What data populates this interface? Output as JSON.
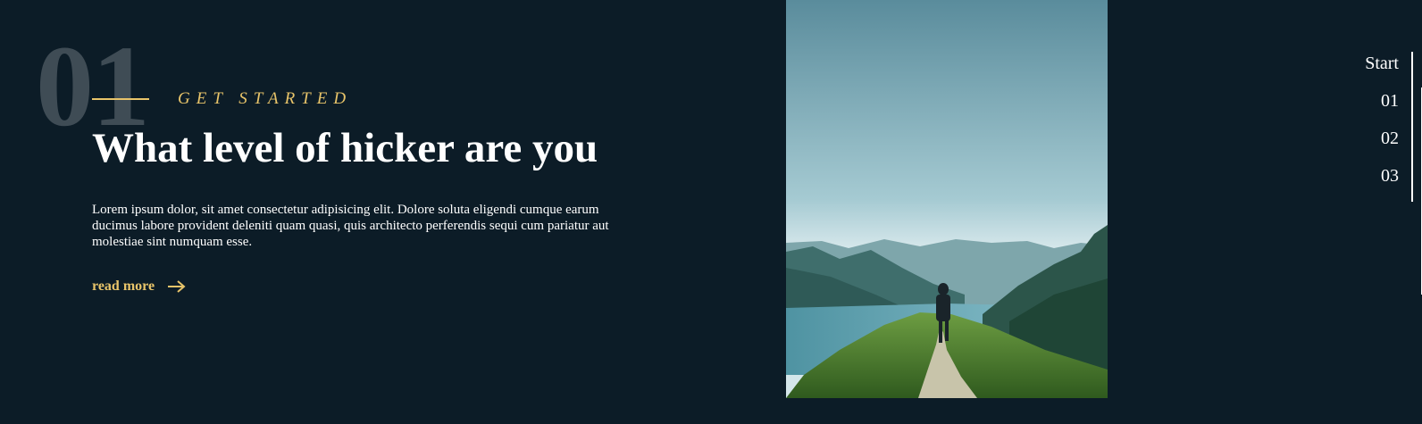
{
  "slide": {
    "number": "01",
    "eyebrow": "GET STARTED",
    "title": "What level of hicker are you",
    "description": "Lorem ipsum dolor, sit amet consectetur adipisicing elit. Dolore soluta eligendi cumque earum ducimus labore provident deleniti quam quasi, quis architecto perferendis sequi cum pariatur aut molestiae sint numquam esse.",
    "read_more_label": "read more"
  },
  "side_nav": {
    "items": [
      {
        "label": "Start"
      },
      {
        "label": "01"
      },
      {
        "label": "02"
      },
      {
        "label": "03"
      }
    ]
  },
  "colors": {
    "background": "#0c1c27",
    "accent": "#e8c46a",
    "big_number": "#3f4c55",
    "text": "#ffffff"
  },
  "icons": {
    "read_more": "arrow-right-icon"
  }
}
